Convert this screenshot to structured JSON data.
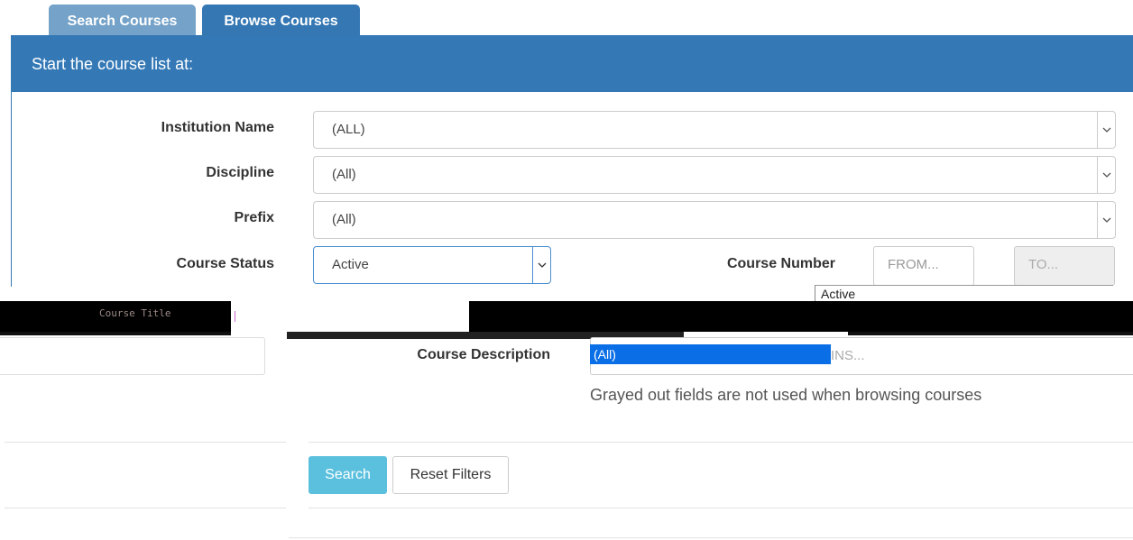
{
  "tabs": [
    {
      "label": "Search Courses"
    },
    {
      "label": "Browse Courses"
    }
  ],
  "panel": {
    "title": "Start the course list at:"
  },
  "fields": {
    "institution": {
      "label": "Institution Name",
      "value": "(ALL)"
    },
    "discipline": {
      "label": "Discipline",
      "value": "(All)"
    },
    "prefix": {
      "label": "Prefix",
      "value": "(All)"
    },
    "status": {
      "label": "Course Status",
      "value": "Active"
    },
    "course_number": {
      "label": "Course Number",
      "from_placeholder": "FROM...",
      "to_placeholder": "TO..."
    },
    "course_title": {
      "label": "Course Title"
    },
    "course_description": {
      "label": "Course Description",
      "placeholder_fragment": "INS..."
    }
  },
  "dropdown": {
    "options": [
      "Active",
      "(All)"
    ],
    "selected": "(All)"
  },
  "helper_text": "Grayed out fields are not used when browsing courses",
  "buttons": {
    "search": "Search",
    "reset": "Reset Filters"
  },
  "colors": {
    "accent": "#3479b6",
    "search_button": "#5bc0de",
    "tab_inactive": "#74a2c8",
    "selection": "#0a6ee6"
  }
}
